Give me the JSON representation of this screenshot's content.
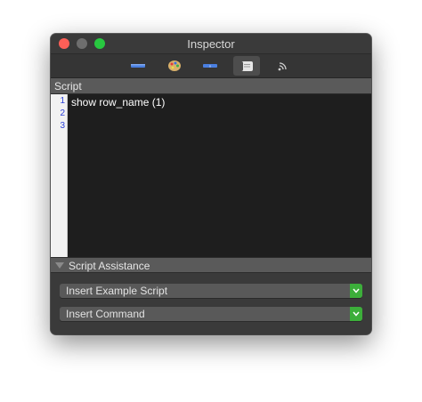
{
  "window": {
    "title": "Inspector"
  },
  "toolbar": {
    "tabs": [
      {
        "icon": "basic-properties-icon",
        "selected": false
      },
      {
        "icon": "color-palette-icon",
        "selected": false
      },
      {
        "icon": "custom-properties-icon",
        "selected": false
      },
      {
        "icon": "script-icon",
        "selected": true
      },
      {
        "icon": "broadcast-icon",
        "selected": false
      }
    ]
  },
  "script": {
    "section_label": "Script",
    "line_numbers": [
      "1",
      "2",
      "3"
    ],
    "lines": [
      "show row_name (1)",
      "",
      ""
    ]
  },
  "assistance": {
    "section_label": "Script Assistance",
    "example_popup": "Insert Example Script",
    "command_popup": "Insert Command"
  },
  "colors": {
    "accent_green": "#3cae3a",
    "line_number_blue": "#2a3fd8"
  }
}
